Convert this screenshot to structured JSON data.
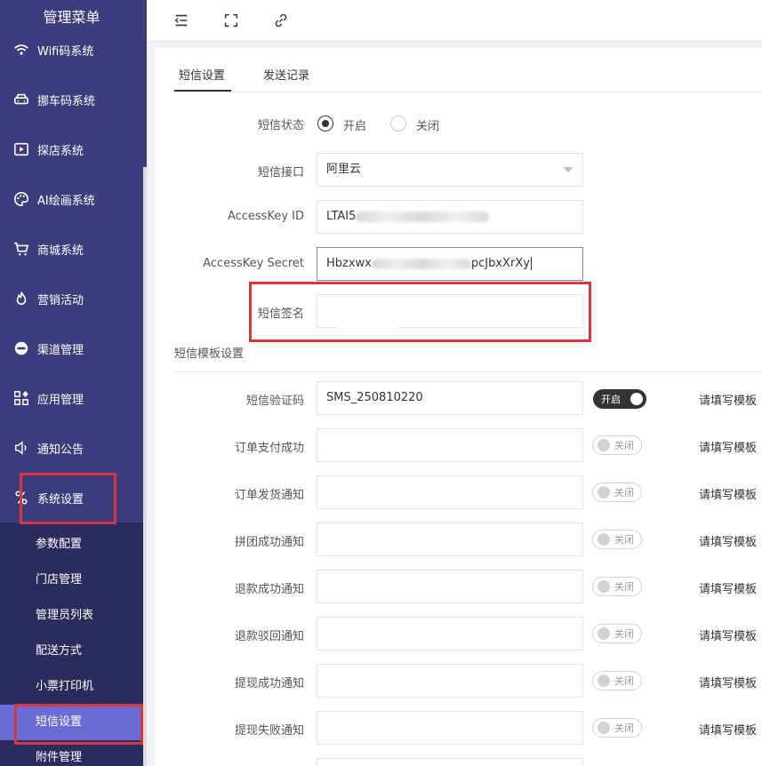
{
  "sidebar": {
    "title": "管理菜单",
    "items": [
      {
        "label": "Wifi码系统",
        "icon": "wifi-icon"
      },
      {
        "label": "挪车码系统",
        "icon": "car-icon"
      },
      {
        "label": "探店系统",
        "icon": "video-icon"
      },
      {
        "label": "AI绘画系统",
        "icon": "palette-icon"
      },
      {
        "label": "商城系统",
        "icon": "cart-icon"
      },
      {
        "label": "营销活动",
        "icon": "fire-icon"
      },
      {
        "label": "渠道管理",
        "icon": "channel-icon"
      },
      {
        "label": "应用管理",
        "icon": "apps-icon"
      },
      {
        "label": "通知公告",
        "icon": "speaker-icon"
      },
      {
        "label": "系统设置",
        "icon": "settings-icon"
      }
    ],
    "subitems": [
      {
        "label": "参数配置"
      },
      {
        "label": "门店管理"
      },
      {
        "label": "管理员列表"
      },
      {
        "label": "配送方式"
      },
      {
        "label": "小票打印机"
      },
      {
        "label": "短信设置"
      },
      {
        "label": "附件管理"
      }
    ],
    "active_sub": "短信设置"
  },
  "toolbar": {
    "icons": [
      "menu-fold-icon",
      "fullscreen-icon",
      "link-icon"
    ]
  },
  "tabs": [
    {
      "label": "短信设置"
    },
    {
      "label": "发送记录"
    }
  ],
  "form": {
    "status_label": "短信状态",
    "status_on": "开启",
    "status_off": "关闭",
    "interface_label": "短信接口",
    "interface_value": "阿里云",
    "access_id_label": "AccessKey ID",
    "access_id_value": "LTAI5",
    "access_secret_label": "AccessKey Secret",
    "access_secret_value": "Hbzxwx",
    "access_secret_value_tail": "pcJbxXrXy",
    "sign_label": "短信签名",
    "sign_value": ""
  },
  "templates": {
    "section_title": "短信模板设置",
    "hint": "请填写模板",
    "rows": [
      {
        "label": "短信验证码",
        "value": "SMS_250810220",
        "switch": "开启",
        "on": true
      },
      {
        "label": "订单支付成功",
        "value": "",
        "switch": "关闭",
        "on": false
      },
      {
        "label": "订单发货通知",
        "value": "",
        "switch": "关闭",
        "on": false
      },
      {
        "label": "拼团成功通知",
        "value": "",
        "switch": "关闭",
        "on": false
      },
      {
        "label": "退款成功通知",
        "value": "",
        "switch": "关闭",
        "on": false
      },
      {
        "label": "退款驳回通知",
        "value": "",
        "switch": "关闭",
        "on": false
      },
      {
        "label": "提现成功通知",
        "value": "",
        "switch": "关闭",
        "on": false
      },
      {
        "label": "提现失败通知",
        "value": "",
        "switch": "关闭",
        "on": false
      }
    ]
  },
  "colors": {
    "sidebar_bg": "#3d3d7e",
    "submenu_bg": "#2b2b5e",
    "active_bg": "#6b6bd6",
    "highlight_red": "#d9363e"
  }
}
